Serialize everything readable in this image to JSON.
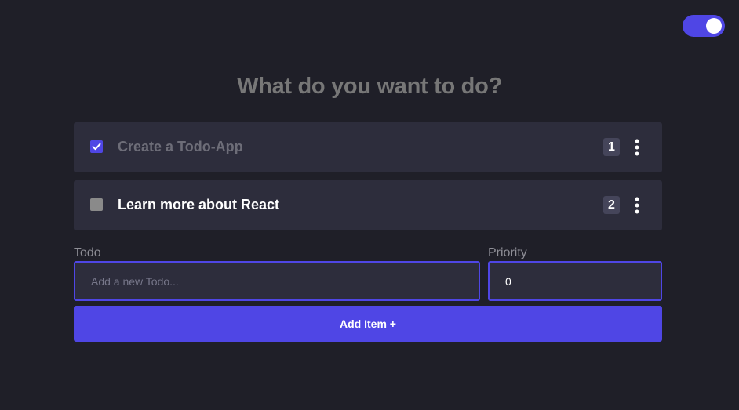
{
  "theme_toggle": {
    "state": "on"
  },
  "heading": "What do you want to do?",
  "todos": [
    {
      "text": "Create a Todo-App",
      "done": true,
      "priority": "1",
      "menu_icon": "more-vertical-icon"
    },
    {
      "text": "Learn more about React",
      "done": false,
      "priority": "2",
      "menu_icon": "more-vertical-icon"
    }
  ],
  "form": {
    "todo_label": "Todo",
    "todo_placeholder": "Add a new Todo...",
    "todo_value": "",
    "priority_label": "Priority",
    "priority_value": "0",
    "add_button_label": "Add Item +"
  },
  "colors": {
    "background": "#1f1f28",
    "card": "#2d2d3c",
    "accent": "#4f46e5",
    "heading": "#777777"
  }
}
